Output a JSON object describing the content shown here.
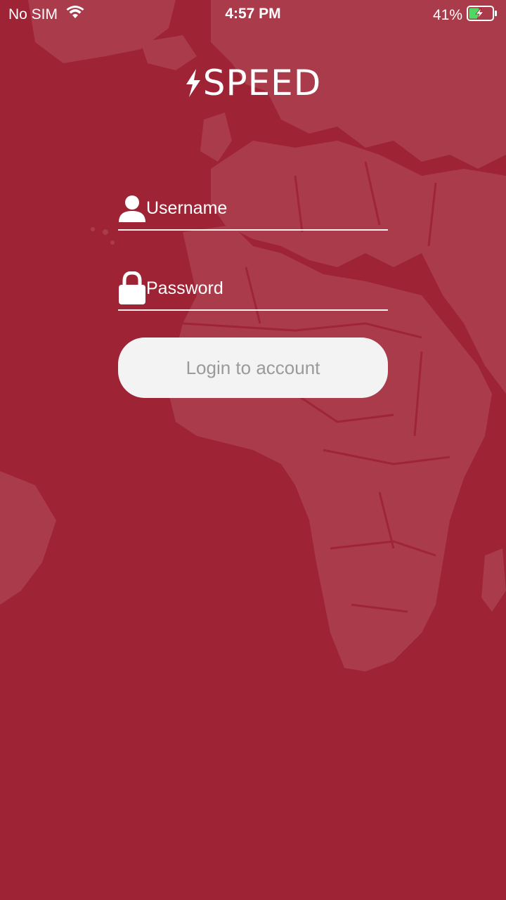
{
  "status_bar": {
    "carrier": "No SIM",
    "time": "4:57 PM",
    "battery_percent": "41%",
    "icons": [
      "wifi-icon",
      "battery-charging-icon"
    ]
  },
  "logo": {
    "text": "SPEED",
    "icon": "lightning-bolt-icon"
  },
  "form": {
    "username": {
      "placeholder": "Username",
      "value": "",
      "icon": "user-icon"
    },
    "password": {
      "placeholder": "Password",
      "value": "",
      "icon": "lock-icon"
    },
    "login_label": "Login to account"
  },
  "colors": {
    "background": "#9e2334",
    "map_land": "#a93a4a",
    "text": "#ffffff",
    "button_bg": "#f3f3f3",
    "button_text": "#9a9a9a",
    "battery_fill": "#4cd964"
  }
}
